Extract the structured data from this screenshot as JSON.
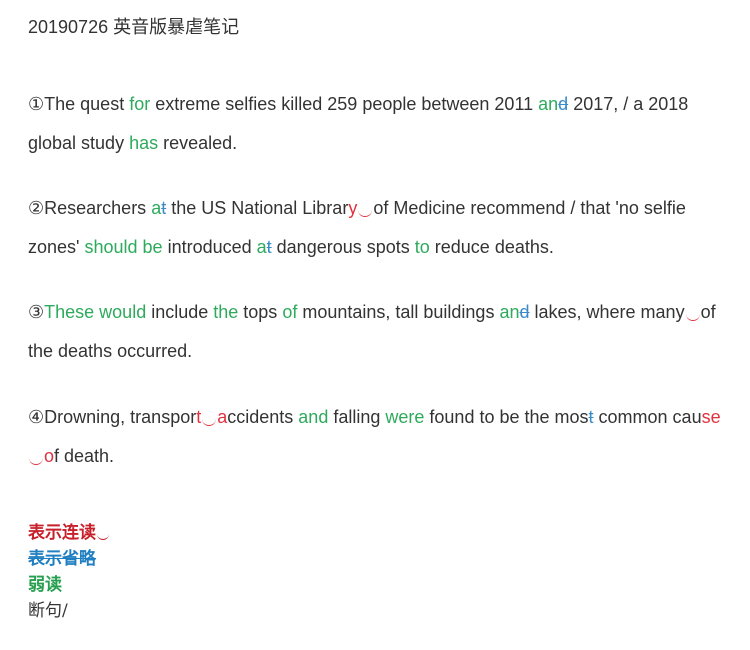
{
  "title": "20190726 英音版暴虐笔记",
  "paragraphs": {
    "p1": {
      "num": "①",
      "s1": "The quest ",
      "w1": "for",
      "s2": " extreme selfies killed 259 people between 2011 ",
      "w2": "an",
      "o1": "d",
      "s3": " 2017,  / ",
      "s4": "a 2018 global study ",
      "w3": "has",
      "s5": " revealed."
    },
    "p2": {
      "num": "②",
      "s1": "Researchers ",
      "w1": "a",
      "o1": "t",
      "s2": " the US National Librar",
      "r1": "y",
      "s3": "of Medicine recommend  /  that 'no selfie zones' ",
      "w2": "should be",
      "s4": " introduced ",
      "w3": "a",
      "o2": "t",
      "s5": " dangerous spots ",
      "w4": "to",
      "s6": " reduce deaths."
    },
    "p3": {
      "num": "③",
      "w1": "These would",
      "s1": " include ",
      "w2": "the",
      "s2": " tops ",
      "w3": "of",
      "s3": " mountains, tall buildings ",
      "w4": "an",
      "o1": "d",
      "s4": " lakes, where many",
      "s5": "of the deaths occurred."
    },
    "p4": {
      "num": "④",
      "s1": "Drowning, transpor",
      "r1": "t",
      "r2": "a",
      "s2": "ccidents ",
      "w1": "and",
      "s3": " falling ",
      "w2": "were",
      "s4": " found to be the mos",
      "o1": "t",
      "s5": " common cau",
      "r3": "se",
      "r4": "o",
      "s6": "f death."
    }
  },
  "legend": {
    "linking": "表示连读",
    "omission": "表示省略",
    "weak": "弱读",
    "sentence_break": "断句/"
  },
  "colors": {
    "weak": "#2eaa5c",
    "linking": "#e0323e",
    "omission": "#3a8bc8",
    "text": "#333333"
  }
}
